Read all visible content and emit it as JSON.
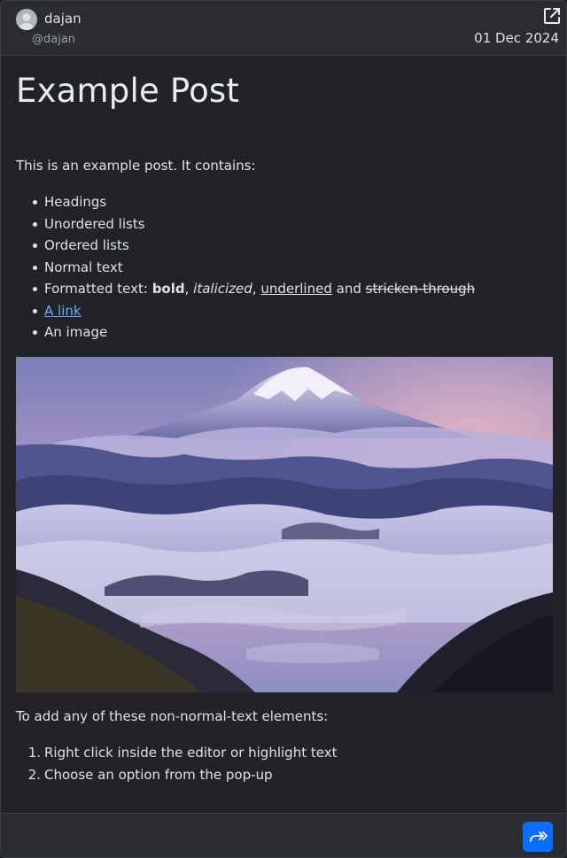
{
  "post": {
    "author_name": "dajan",
    "author_handle": "@dajan",
    "date": "01 Dec 2024",
    "title": "Example Post",
    "intro": "This is an example post. It contains:",
    "features": {
      "headings": "Headings",
      "unordered": "Unordered lists",
      "ordered": "Ordered lists",
      "normal": "Normal text",
      "formatted_prefix": "Formatted text: ",
      "bold": "bold",
      "sep1": ", ",
      "italic": "italicized",
      "sep2": ", ",
      "underlined": "underlined",
      "and": " and ",
      "strike": "stricken-through",
      "link": "A link",
      "image": "An image"
    },
    "outro": "To add any of these non-normal-text elements:",
    "steps": [
      {
        "num": "1.",
        "text": "Right click inside the editor or highlight text"
      },
      {
        "num": "2.",
        "text": "Choose an option from the pop-up"
      }
    ]
  },
  "icons": {
    "external": "external-link-icon",
    "share": "share-forward-icon",
    "avatar": "user-avatar-icon"
  },
  "colors": {
    "accent": "#0d6efd",
    "link": "#6ea8fe",
    "background": "#212327"
  }
}
